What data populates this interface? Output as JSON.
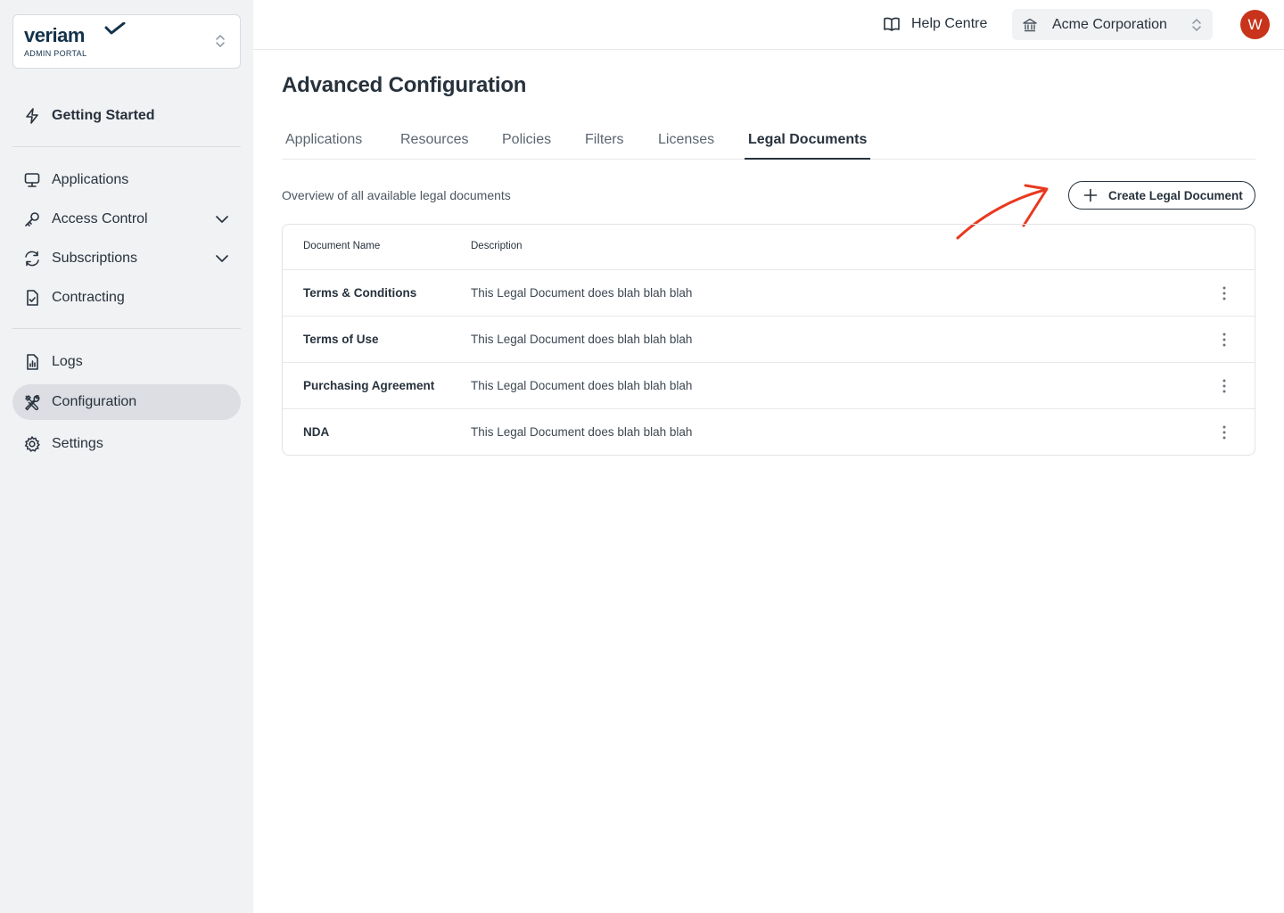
{
  "brand": {
    "name": "veriam",
    "subtitle": "ADMIN PORTAL"
  },
  "sidebar": {
    "items": [
      {
        "label": "Getting Started",
        "icon": "bolt-icon"
      },
      {
        "label": "Applications",
        "icon": "monitor-icon"
      },
      {
        "label": "Access Control",
        "icon": "key-icon",
        "expandable": true
      },
      {
        "label": "Subscriptions",
        "icon": "refresh-icon",
        "expandable": true
      },
      {
        "label": "Contracting",
        "icon": "file-check-icon"
      },
      {
        "label": "Logs",
        "icon": "file-chart-icon"
      },
      {
        "label": "Configuration",
        "icon": "tools-icon",
        "active": true
      },
      {
        "label": "Settings",
        "icon": "gear-icon"
      }
    ]
  },
  "topbar": {
    "help_label": "Help Centre",
    "org_label": "Acme Corporation",
    "avatar_initial": "W"
  },
  "page": {
    "title": "Advanced Configuration",
    "tabs": [
      {
        "label": "Applications"
      },
      {
        "label": "Resources"
      },
      {
        "label": "Policies"
      },
      {
        "label": "Filters"
      },
      {
        "label": "Licenses"
      },
      {
        "label": "Legal Documents",
        "active": true
      }
    ],
    "overview": "Overview of all available legal documents",
    "create_label": "Create Legal Document"
  },
  "table": {
    "columns": [
      "Document Name",
      "Description"
    ],
    "rows": [
      {
        "name": "Terms & Conditions",
        "description": "This Legal Document does blah blah blah"
      },
      {
        "name": "Terms of Use",
        "description": "This Legal Document does blah blah blah"
      },
      {
        "name": "Purchasing Agreement",
        "description": "This Legal Document does blah blah blah"
      },
      {
        "name": "NDA",
        "description": "This Legal Document does blah blah blah"
      }
    ]
  },
  "colors": {
    "brand": "#14324a",
    "accent_avatar": "#c8341b",
    "annotation_arrow": "#e8391f",
    "sidebar_bg": "#f1f2f4",
    "active_nav_bg": "#dcdee3"
  }
}
